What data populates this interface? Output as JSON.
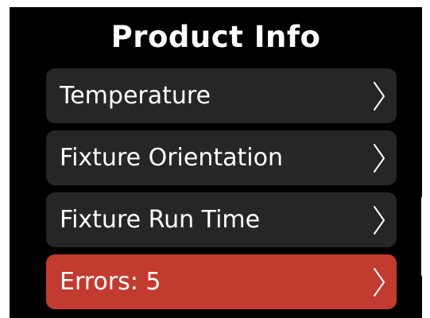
{
  "screen": {
    "title": "Product Info"
  },
  "menu": {
    "items": [
      {
        "label": "Temperature",
        "state": "normal"
      },
      {
        "label": "Fixture Orientation",
        "state": "normal"
      },
      {
        "label": "Fixture Run Time",
        "state": "normal"
      },
      {
        "label": "Errors: 5",
        "state": "error"
      }
    ]
  },
  "icons": {
    "row_arrow": "chevron-right-icon"
  },
  "colors": {
    "background": "#000000",
    "item_background": "#262626",
    "error_background": "#c23b2f",
    "text": "#ffffff",
    "scrollbar": "#ffffff"
  }
}
